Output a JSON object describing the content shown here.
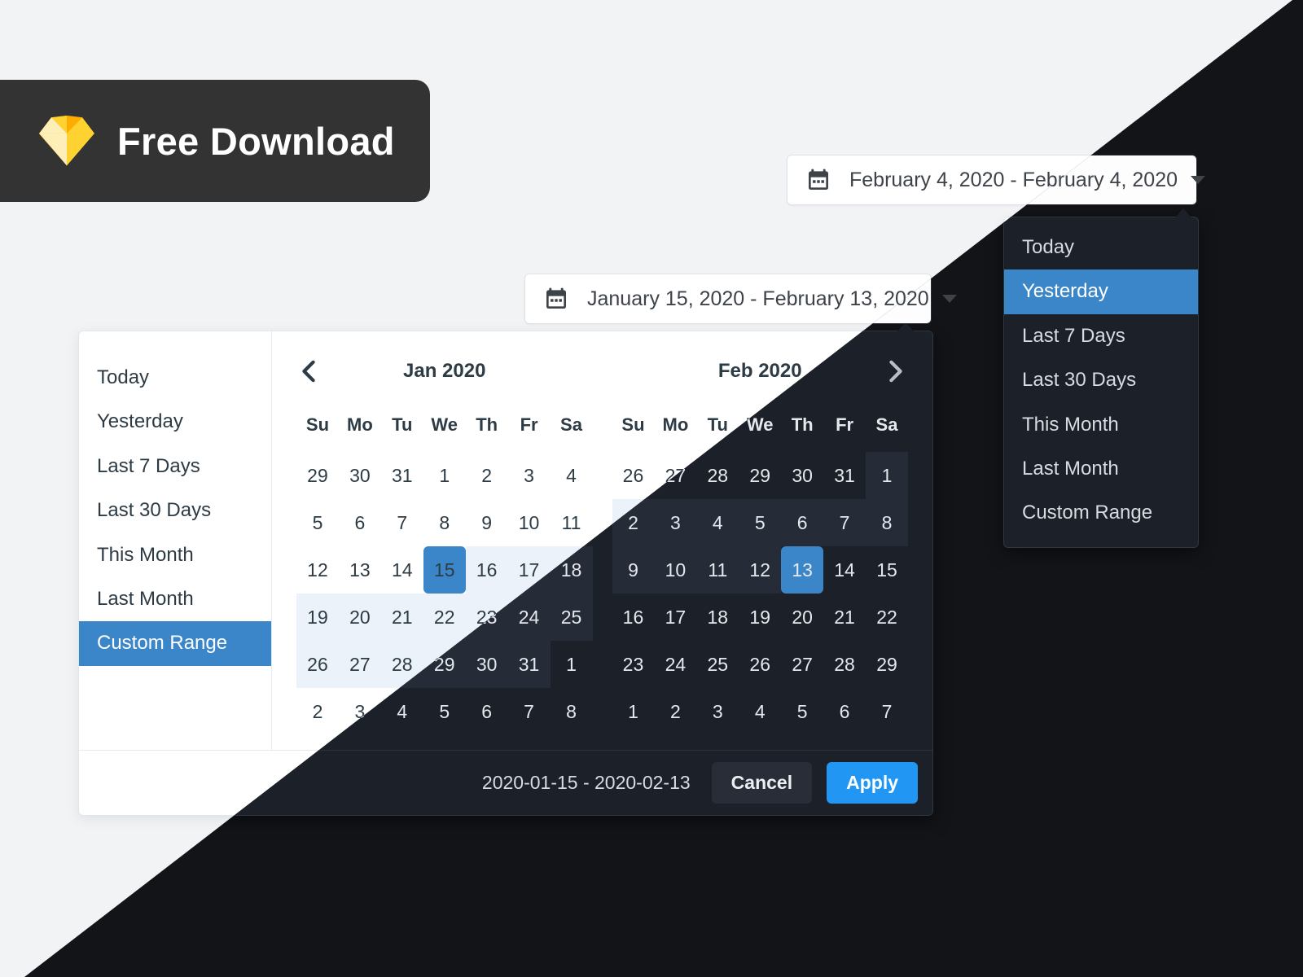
{
  "badge": {
    "label": "Free Download",
    "icon": "sketch-diamond-icon"
  },
  "date_input_top": {
    "value": "February 4, 2020 - February 4, 2020",
    "icon": "calendar-icon",
    "caret": "chevron-down-icon"
  },
  "date_input_bottom": {
    "value": "January 15, 2020 - February 13, 2020",
    "icon": "calendar-icon",
    "caret": "chevron-down-icon"
  },
  "ranges": {
    "items": [
      {
        "label": "Today",
        "selected": false
      },
      {
        "label": "Yesterday",
        "selected": true
      },
      {
        "label": "Last 7 Days",
        "selected": false
      },
      {
        "label": "Last 30 Days",
        "selected": false
      },
      {
        "label": "This Month",
        "selected": false
      },
      {
        "label": "Last Month",
        "selected": false
      },
      {
        "label": "Custom Range",
        "selected": false
      }
    ]
  },
  "sidebar": {
    "items": [
      {
        "label": "Today",
        "selected": false
      },
      {
        "label": "Yesterday",
        "selected": false
      },
      {
        "label": "Last 7 Days",
        "selected": false
      },
      {
        "label": "Last 30 Days",
        "selected": false
      },
      {
        "label": "This Month",
        "selected": false
      },
      {
        "label": "Last Month",
        "selected": false
      },
      {
        "label": "Custom Range",
        "selected": true
      }
    ]
  },
  "calendars": {
    "weekday_headers": [
      "Su",
      "Mo",
      "Tu",
      "We",
      "Th",
      "Fr",
      "Sa"
    ],
    "prev_icon": "chevron-left-icon",
    "next_icon": "chevron-right-icon",
    "left": {
      "title": "Jan 2020",
      "weeks": [
        [
          {
            "d": "29",
            "s": "off"
          },
          {
            "d": "30",
            "s": "off"
          },
          {
            "d": "31",
            "s": "off"
          },
          {
            "d": "1",
            "s": ""
          },
          {
            "d": "2",
            "s": ""
          },
          {
            "d": "3",
            "s": ""
          },
          {
            "d": "4",
            "s": ""
          }
        ],
        [
          {
            "d": "5",
            "s": ""
          },
          {
            "d": "6",
            "s": ""
          },
          {
            "d": "7",
            "s": ""
          },
          {
            "d": "8",
            "s": ""
          },
          {
            "d": "9",
            "s": ""
          },
          {
            "d": "10",
            "s": ""
          },
          {
            "d": "11",
            "s": ""
          }
        ],
        [
          {
            "d": "12",
            "s": ""
          },
          {
            "d": "13",
            "s": ""
          },
          {
            "d": "14",
            "s": ""
          },
          {
            "d": "15",
            "s": "sel"
          },
          {
            "d": "16",
            "s": "in-range"
          },
          {
            "d": "17",
            "s": "in-range"
          },
          {
            "d": "18",
            "s": "in-range"
          }
        ],
        [
          {
            "d": "19",
            "s": "in-range"
          },
          {
            "d": "20",
            "s": "in-range"
          },
          {
            "d": "21",
            "s": "in-range"
          },
          {
            "d": "22",
            "s": "in-range"
          },
          {
            "d": "23",
            "s": "in-range"
          },
          {
            "d": "24",
            "s": "in-range"
          },
          {
            "d": "25",
            "s": "in-range"
          }
        ],
        [
          {
            "d": "26",
            "s": "in-range"
          },
          {
            "d": "27",
            "s": "in-range"
          },
          {
            "d": "28",
            "s": "in-range"
          },
          {
            "d": "29",
            "s": "in-range"
          },
          {
            "d": "30",
            "s": "in-range"
          },
          {
            "d": "31",
            "s": "in-range"
          },
          {
            "d": "1",
            "s": "off"
          }
        ],
        [
          {
            "d": "2",
            "s": "off"
          },
          {
            "d": "3",
            "s": "off"
          },
          {
            "d": "4",
            "s": "off"
          },
          {
            "d": "5",
            "s": "off"
          },
          {
            "d": "6",
            "s": "off"
          },
          {
            "d": "7",
            "s": "off"
          },
          {
            "d": "8",
            "s": "off"
          }
        ]
      ]
    },
    "right": {
      "title": "Feb 2020",
      "weeks": [
        [
          {
            "d": "26",
            "s": "off"
          },
          {
            "d": "27",
            "s": "off"
          },
          {
            "d": "28",
            "s": "off"
          },
          {
            "d": "29",
            "s": "off"
          },
          {
            "d": "30",
            "s": "off"
          },
          {
            "d": "31",
            "s": "off"
          },
          {
            "d": "1",
            "s": "in-range"
          }
        ],
        [
          {
            "d": "2",
            "s": "in-range"
          },
          {
            "d": "3",
            "s": "in-range"
          },
          {
            "d": "4",
            "s": "in-range"
          },
          {
            "d": "5",
            "s": "in-range"
          },
          {
            "d": "6",
            "s": "in-range"
          },
          {
            "d": "7",
            "s": "in-range"
          },
          {
            "d": "8",
            "s": "in-range"
          }
        ],
        [
          {
            "d": "9",
            "s": "in-range"
          },
          {
            "d": "10",
            "s": "in-range"
          },
          {
            "d": "11",
            "s": "in-range"
          },
          {
            "d": "12",
            "s": "in-range"
          },
          {
            "d": "13",
            "s": "sel"
          },
          {
            "d": "14",
            "s": ""
          },
          {
            "d": "15",
            "s": ""
          }
        ],
        [
          {
            "d": "16",
            "s": ""
          },
          {
            "d": "17",
            "s": ""
          },
          {
            "d": "18",
            "s": ""
          },
          {
            "d": "19",
            "s": ""
          },
          {
            "d": "20",
            "s": ""
          },
          {
            "d": "21",
            "s": ""
          },
          {
            "d": "22",
            "s": ""
          }
        ],
        [
          {
            "d": "23",
            "s": ""
          },
          {
            "d": "24",
            "s": ""
          },
          {
            "d": "25",
            "s": ""
          },
          {
            "d": "26",
            "s": ""
          },
          {
            "d": "27",
            "s": ""
          },
          {
            "d": "28",
            "s": ""
          },
          {
            "d": "29",
            "s": ""
          }
        ],
        [
          {
            "d": "1",
            "s": "off"
          },
          {
            "d": "2",
            "s": "off"
          },
          {
            "d": "3",
            "s": "off"
          },
          {
            "d": "4",
            "s": "off"
          },
          {
            "d": "5",
            "s": "off"
          },
          {
            "d": "6",
            "s": "off"
          },
          {
            "d": "7",
            "s": "off"
          }
        ]
      ]
    }
  },
  "footer": {
    "range_text": "2020-01-15 - 2020-02-13",
    "cancel_label": "Cancel",
    "apply_label": "Apply"
  },
  "colors": {
    "accent_blue": "#3a86c8",
    "apply_blue": "#2196f3",
    "light_bg": "#f1f3f5",
    "dark_bg": "#121418",
    "dark_panel": "#1c2029",
    "range_light": "#ebf2f9",
    "range_dark": "#262b38"
  }
}
